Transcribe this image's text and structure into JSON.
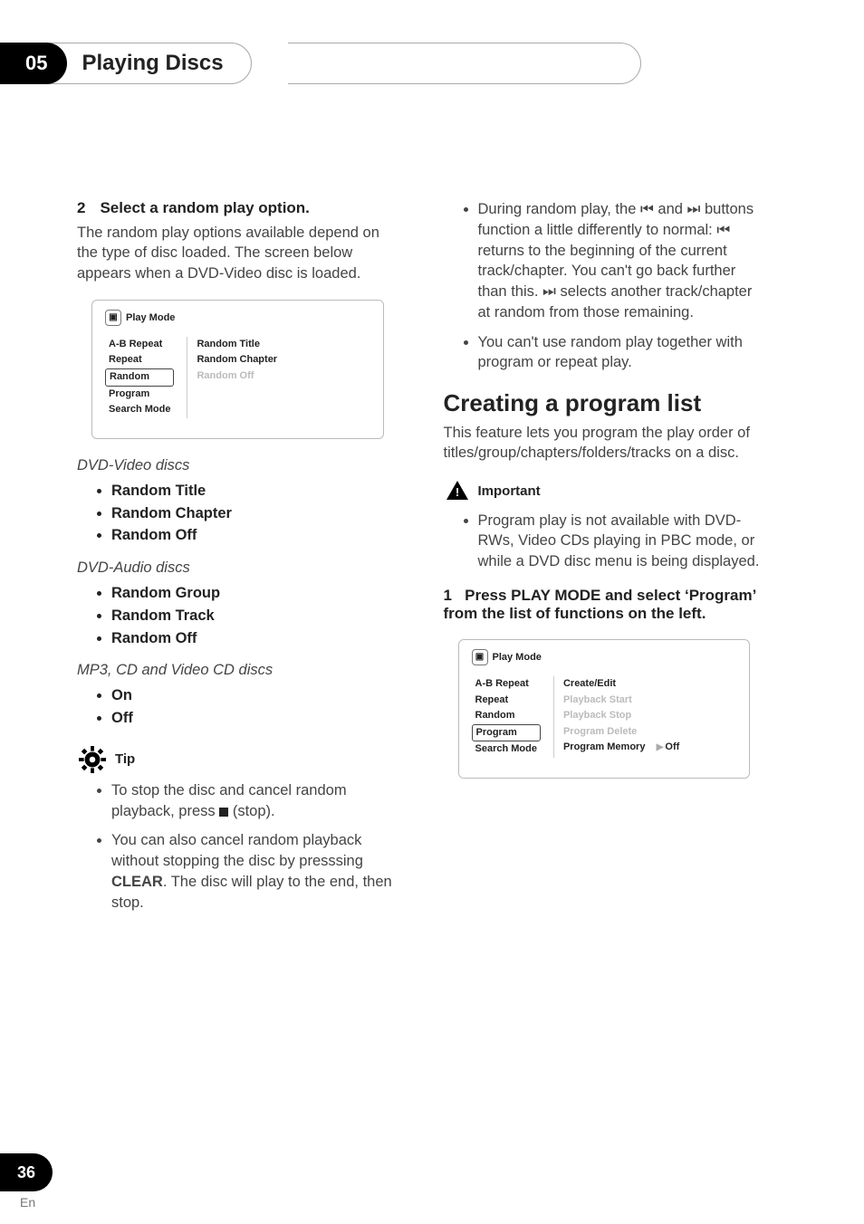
{
  "header": {
    "chapter": "05",
    "sectionTitle": "Playing Discs"
  },
  "left": {
    "step": {
      "num": "2",
      "text": "Select a random play option."
    },
    "intro": "The random play options available depend on the type of disc loaded. The screen below appears when a DVD-Video disc is loaded.",
    "gui1": {
      "title": "Play Mode",
      "menu": [
        "A-B Repeat",
        "Repeat",
        "Random",
        "Program",
        "Search Mode"
      ],
      "selected": "Random",
      "options": [
        "Random Title",
        "Random Chapter",
        "Random Off"
      ],
      "dim": [
        "Random Off"
      ]
    },
    "caption1": "DVD-Video discs",
    "list1": [
      "Random Title",
      "Random Chapter",
      "Random Off"
    ],
    "caption2": "DVD-Audio discs",
    "list2": [
      "Random Group",
      "Random Track",
      "Random Off"
    ],
    "caption3": "MP3, CD and Video CD discs",
    "list3": [
      "On",
      "Off"
    ],
    "tipLabel": "Tip",
    "tips_0_a": "To stop the disc and cancel random playback, press ",
    "tips_0_b": " (stop).",
    "tips_1_a": "You can also cancel random playback without stopping the disc by presssing ",
    "tips_1_bold": "CLEAR",
    "tips_1_b": ". The disc will play to the end, then stop."
  },
  "right": {
    "bullets_skip_a": "During random play, the ",
    "bullets_skip_b": " and ",
    "bullets_skip_c": " buttons function a little differently to normal: ",
    "bullets_skip_d": " returns to the beginning of the current track/chapter. You can't go back further than this. ",
    "bullets_skip_e": " selects another track/chapter at random from those remaining.",
    "bullets_1": "You can't use random play together with program or repeat play.",
    "heading": "Creating a program list",
    "intro": "This feature lets you program the play order of titles/group/chapters/folders/tracks on a disc.",
    "importantLabel": "Important",
    "important": "Program play is not available with DVD-RWs, Video CDs playing in PBC mode, or while a DVD disc menu is being displayed.",
    "step": {
      "num": "1",
      "text": "Press PLAY MODE and select ‘Program’ from the list of functions on the left."
    },
    "gui2": {
      "title": "Play Mode",
      "menu": [
        "A-B Repeat",
        "Repeat",
        "Random",
        "Program",
        "Search Mode"
      ],
      "selected": "Program",
      "options": [
        "Create/Edit",
        "Playback Start",
        "Playback Stop",
        "Program Delete",
        "Program Memory"
      ],
      "dim": [
        "Playback Start",
        "Playback Stop",
        "Program Delete"
      ],
      "extra": "Off"
    }
  },
  "footer": {
    "page": "36",
    "lang": "En"
  }
}
